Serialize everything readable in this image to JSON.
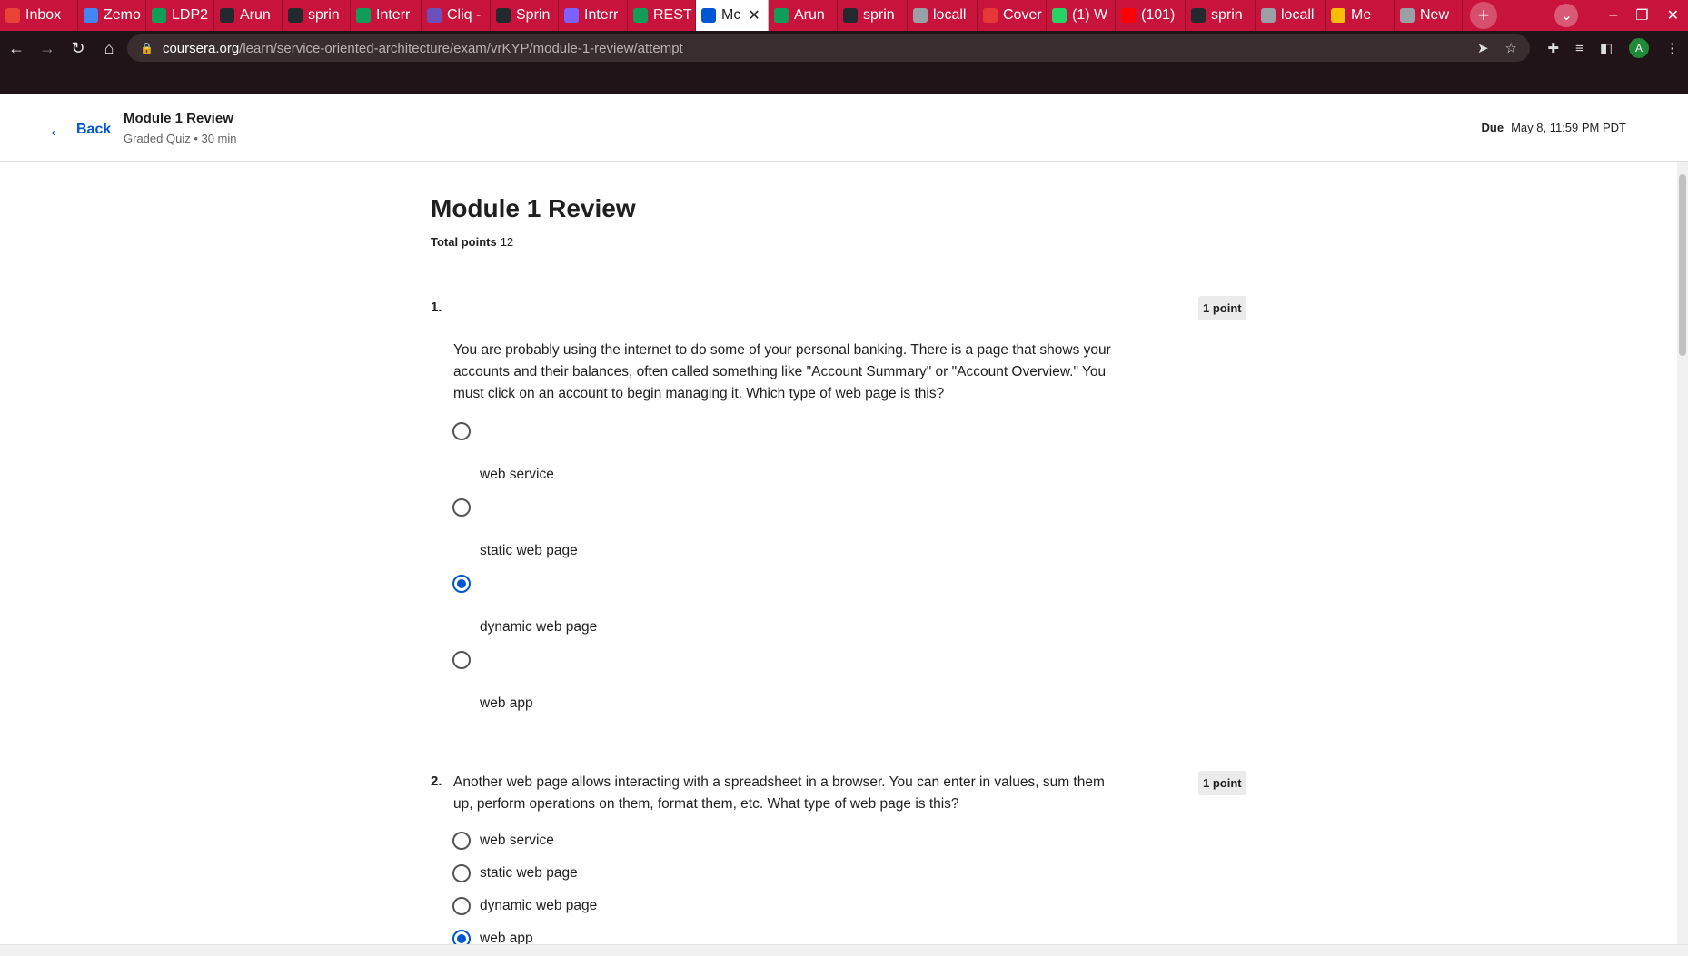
{
  "browser": {
    "tabs": [
      {
        "label": "Inbox",
        "color": "#ea4335",
        "icon": "gmail-icon"
      },
      {
        "label": "Zemo",
        "color": "#4285f4",
        "icon": "calendar-icon"
      },
      {
        "label": "LDP2",
        "color": "#0f9d58",
        "icon": "sheets-icon"
      },
      {
        "label": "Arun",
        "color": "#24292e",
        "icon": "github-icon"
      },
      {
        "label": "sprin",
        "color": "#24292e",
        "icon": "github-icon"
      },
      {
        "label": "Interr",
        "color": "#0f9d58",
        "icon": "sheets-icon"
      },
      {
        "label": "Cliq -",
        "color": "#6b4fbb",
        "icon": "cliq-icon"
      },
      {
        "label": "Sprin",
        "color": "#24292e",
        "icon": "github-icon"
      },
      {
        "label": "Interr",
        "color": "#7b61ff",
        "icon": "link-icon"
      },
      {
        "label": "REST",
        "color": "#0f9d58",
        "icon": "classroom-icon"
      },
      {
        "label": "Mc",
        "color": "#0056d2",
        "icon": "coursera-icon",
        "active": true
      },
      {
        "label": "Arun",
        "color": "#0f9d58",
        "icon": "sheets-icon"
      },
      {
        "label": "sprin",
        "color": "#24292e",
        "icon": "github-icon"
      },
      {
        "label": "locall",
        "color": "#9aa0a6",
        "icon": "globe-icon"
      },
      {
        "label": "Cover",
        "color": "#e53935",
        "icon": "circle-icon"
      },
      {
        "label": "(1) W",
        "color": "#25d366",
        "icon": "whatsapp-icon"
      },
      {
        "label": "(101)",
        "color": "#ff0000",
        "icon": "youtube-icon"
      },
      {
        "label": "sprin",
        "color": "#24292e",
        "icon": "github-icon"
      },
      {
        "label": "locall",
        "color": "#9aa0a6",
        "icon": "globe-icon"
      },
      {
        "label": "Me",
        "color": "#fbbc05",
        "icon": "meet-icon"
      },
      {
        "label": "New",
        "color": "#9aa0a6",
        "icon": "chrome-icon"
      }
    ],
    "url_domain": "coursera.org",
    "url_path": "/learn/service-oriented-architecture/exam/vrKYP/module-1-review/attempt",
    "profile_initial": "A"
  },
  "header": {
    "back_label": "Back",
    "title": "Module 1 Review",
    "subtitle": "Graded Quiz • 30 min",
    "due_label": "Due",
    "due_value": "May 8, 11:59 PM PDT"
  },
  "quiz": {
    "title": "Module 1 Review",
    "total_label": "Total points",
    "total_value": "12",
    "questions": [
      {
        "number": "1.",
        "points": "1 point",
        "text": "You are probably using the internet to do some of your personal banking. There is a page that shows your accounts and their balances, often called something like \"Account Summary\" or \"Account Overview.\" You must click on an account to begin managing it. Which type of web page is this?",
        "options": [
          "web service",
          "static web page",
          "dynamic web page",
          "web app"
        ],
        "selected": 2
      },
      {
        "number": "2.",
        "points": "1 point",
        "text": "Another web page allows interacting with a spreadsheet in a browser. You can enter in values, sum them up, perform operations on them, format them, etc. What type of web page is this?",
        "options": [
          "web service",
          "static web page",
          "dynamic web page",
          "web app"
        ],
        "selected": 3
      }
    ]
  }
}
